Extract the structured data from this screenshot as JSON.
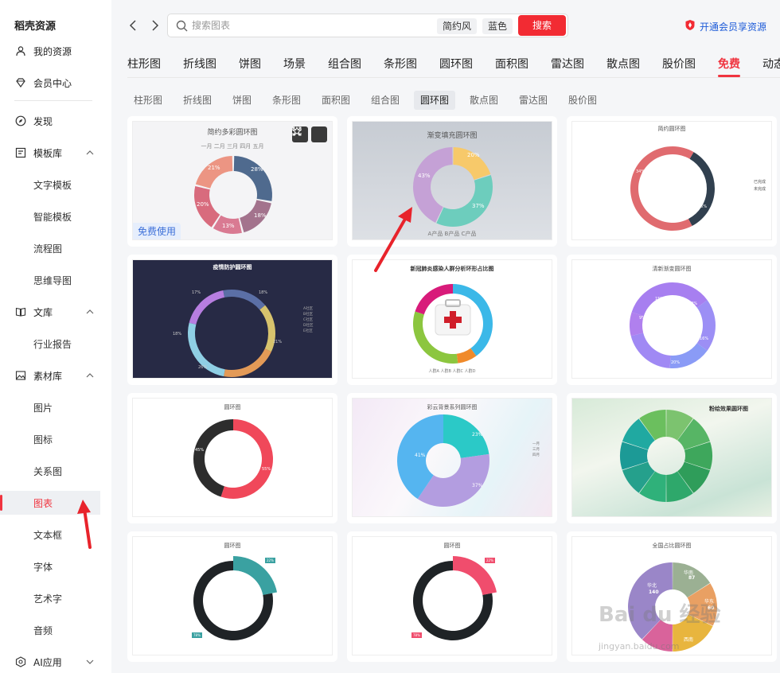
{
  "brand": "稻壳资源",
  "sidebar": {
    "items": [
      {
        "label": "我的资源",
        "icon": "user-icon"
      },
      {
        "label": "会员中心",
        "icon": "diamond-icon"
      },
      {
        "label": "发现",
        "icon": "compass-icon"
      },
      {
        "label": "模板库",
        "icon": "template-icon"
      },
      {
        "label": "文库",
        "icon": "book-icon"
      },
      {
        "label": "素材库",
        "icon": "image-icon"
      },
      {
        "label": "AI应用",
        "icon": "ai-icon"
      }
    ],
    "template_sub": [
      "文字模板",
      "智能模板",
      "流程图",
      "思维导图"
    ],
    "library_sub": [
      "行业报告"
    ],
    "material_sub": [
      "图片",
      "图标",
      "关系图",
      "图表",
      "文本框",
      "字体",
      "艺术字",
      "音频"
    ]
  },
  "search": {
    "placeholder": "搜索图表",
    "chip1": "简约风",
    "chip2": "蓝色",
    "button": "搜索"
  },
  "vip_link": "开通会员享资源",
  "category_tabs": [
    "柱形图",
    "折线图",
    "饼图",
    "场景",
    "组合图",
    "条形图",
    "圆环图",
    "面积图",
    "雷达图",
    "散点图",
    "股价图",
    "免费",
    "动态"
  ],
  "sub_tabs": [
    "柱形图",
    "折线图",
    "饼图",
    "条形图",
    "面积图",
    "组合图",
    "圆环图",
    "散点图",
    "雷达图",
    "股价图"
  ],
  "cards": [
    {
      "title": "简约多彩圆环图",
      "free": "免费使用",
      "legend": "一月  二月  三月  四月  五月",
      "labels": [
        "28%",
        "18%",
        "13%",
        "20%",
        "21%"
      ]
    },
    {
      "title": "渐变填充圆环图",
      "legend": "A产品  B产品  C产品",
      "labels": [
        "20%",
        "37%",
        "43%"
      ]
    },
    {
      "title": "简约圆环图",
      "legend1": "已完成",
      "legend2": "未完成",
      "labels": [
        "34%",
        "66%"
      ]
    },
    {
      "title": "疫情防护圆环图",
      "labels": [
        "18%",
        "21%",
        "26%",
        "18%",
        "17%"
      ],
      "legend": [
        "A社区",
        "B社区",
        "C社区",
        "D社区",
        "E社区"
      ]
    },
    {
      "title": "新冠肺炎感染人群分析环形占比图",
      "legend": "人群A  人群B  人群C  人群D"
    },
    {
      "title": "清新渐变圆环图",
      "labels": [
        "15%",
        "20%",
        "16%",
        "20%",
        "9%"
      ]
    },
    {
      "title": "圆环图",
      "labels": [
        "45%",
        "55%"
      ]
    },
    {
      "title": "彩云背景系列圆环图",
      "labels": [
        "23%",
        "37%",
        "41%"
      ],
      "legend": [
        "一月",
        "三月",
        "四月"
      ]
    },
    {
      "title": "粉绘效果圆环图"
    },
    {
      "title": "圆环图",
      "labels": [
        "78%",
        "22%"
      ]
    },
    {
      "title": "圆环图",
      "labels": [
        "22%",
        "78%"
      ]
    },
    {
      "title": "全国占比圆环图",
      "labels": [
        "华北",
        "华南",
        "华东",
        "西南"
      ],
      "values": [
        "140",
        "87",
        "60"
      ]
    }
  ],
  "watermark": "Bai du 经验",
  "watermark_url": "jingyan.baidu.com",
  "colors": {
    "accent": "#f0343f",
    "link": "#1d5bd8"
  }
}
